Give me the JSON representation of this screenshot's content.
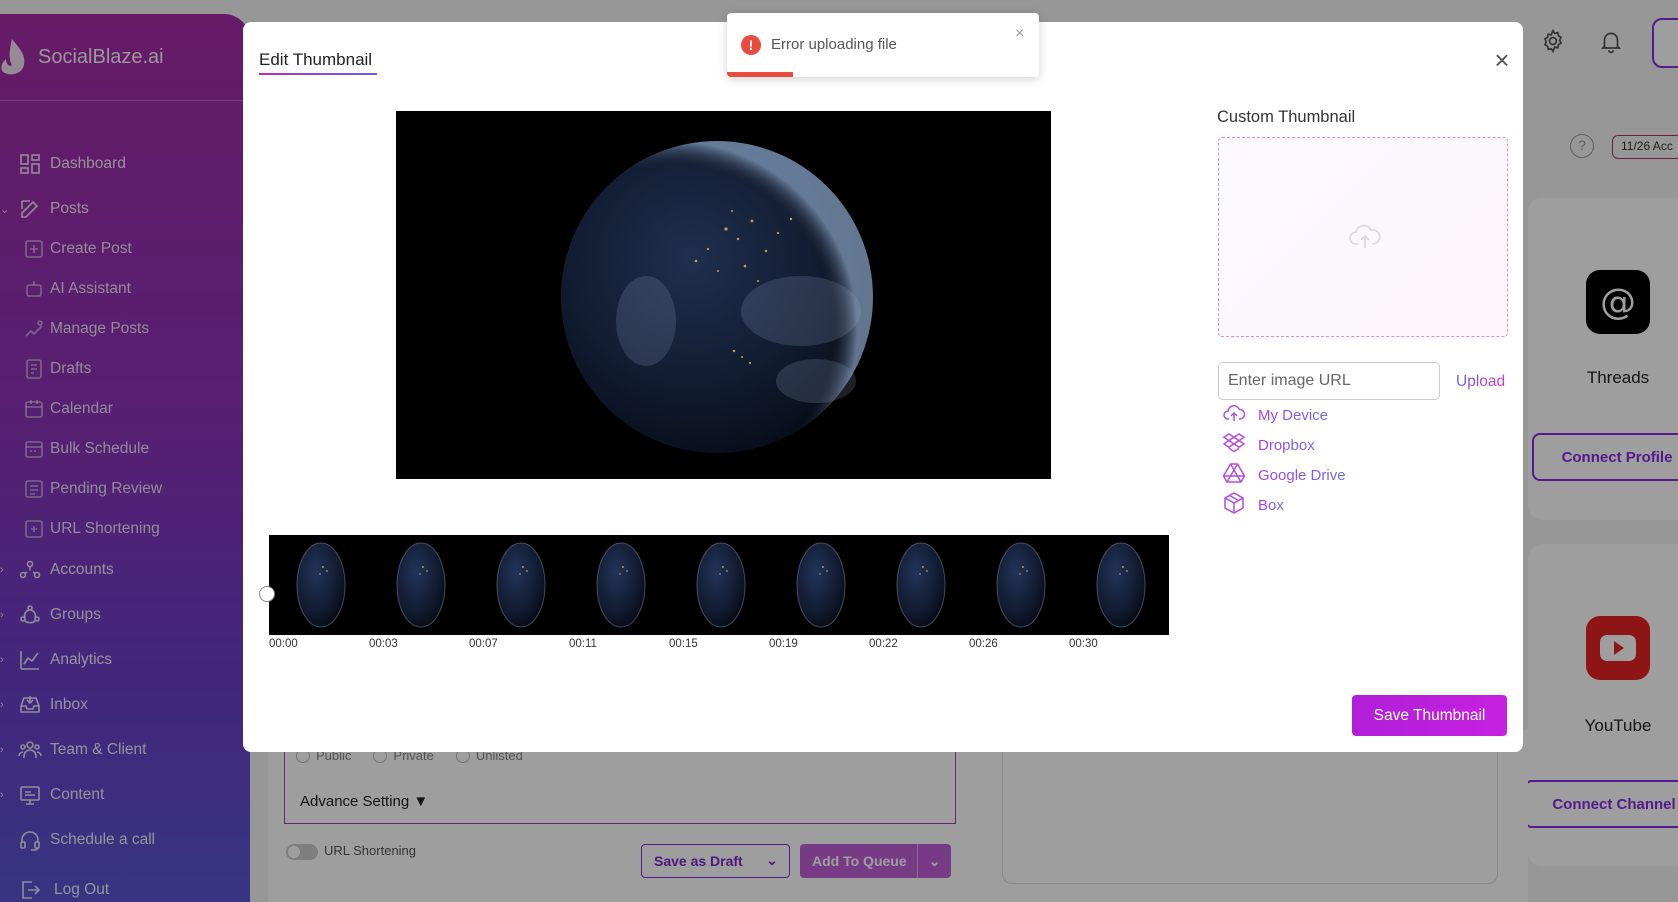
{
  "brand": {
    "name": "SocialBlaze.ai"
  },
  "sidebar": {
    "items": [
      {
        "label": "Dashboard",
        "icon": "dashboard-icon",
        "chevron": false,
        "sub": false
      },
      {
        "label": "Posts",
        "icon": "edit-icon",
        "chevron": "down",
        "sub": false
      },
      {
        "label": "Create Post",
        "icon": "create-post-icon",
        "chevron": false,
        "sub": true
      },
      {
        "label": "AI Assistant",
        "icon": "robot-icon",
        "chevron": false,
        "sub": true
      },
      {
        "label": "Manage Posts",
        "icon": "manage-icon",
        "chevron": false,
        "sub": true
      },
      {
        "label": "Drafts",
        "icon": "drafts-icon",
        "chevron": false,
        "sub": true
      },
      {
        "label": "Calendar",
        "icon": "calendar-icon",
        "chevron": false,
        "sub": true
      },
      {
        "label": "Bulk Schedule",
        "icon": "bulk-icon",
        "chevron": false,
        "sub": true
      },
      {
        "label": "Pending Review",
        "icon": "review-icon",
        "chevron": false,
        "sub": true
      },
      {
        "label": "URL Shortening",
        "icon": "link-icon",
        "chevron": false,
        "sub": true
      },
      {
        "label": "Accounts",
        "icon": "accounts-icon",
        "chevron": "right",
        "sub": false
      },
      {
        "label": "Groups",
        "icon": "groups-icon",
        "chevron": "right",
        "sub": false
      },
      {
        "label": "Analytics",
        "icon": "analytics-icon",
        "chevron": "right",
        "sub": false
      },
      {
        "label": "Inbox",
        "icon": "inbox-icon",
        "chevron": "right",
        "sub": false
      },
      {
        "label": "Team & Client",
        "icon": "team-icon",
        "chevron": "right",
        "sub": false
      },
      {
        "label": "Content",
        "icon": "content-icon",
        "chevron": "right",
        "sub": false
      },
      {
        "label": "Schedule a call",
        "icon": "headset-icon",
        "chevron": false,
        "sub": false
      },
      {
        "label": "Log Out",
        "icon": "logout-icon",
        "chevron": false,
        "sub": false
      }
    ]
  },
  "background": {
    "accounts_count": "11/26 Acc",
    "help": "?",
    "platforms": [
      {
        "name": "Threads",
        "button": "Connect Profile"
      },
      {
        "name": "YouTube",
        "button": "Connect Channel"
      }
    ],
    "visibility_options": [
      "Public",
      "Private",
      "Unlisted"
    ],
    "advance_setting": "Advance Setting ▼",
    "url_shortening": "URL Shortening",
    "save_draft": "Save as Draft",
    "add_queue": "Add To Queue"
  },
  "modal": {
    "title": "Edit Thumbnail",
    "close": "×",
    "custom_thumbnail_title": "Custom Thumbnail",
    "url_placeholder": "Enter image URL",
    "upload_label": "Upload",
    "sources": [
      {
        "label": "My Device",
        "icon": "cloud-upload-icon"
      },
      {
        "label": "Dropbox",
        "icon": "dropbox-icon"
      },
      {
        "label": "Google Drive",
        "icon": "google-drive-icon"
      },
      {
        "label": "Box",
        "icon": "box-icon"
      }
    ],
    "timeline": [
      "00:00",
      "00:03",
      "00:07",
      "00:11",
      "00:15",
      "00:19",
      "00:22",
      "00:26",
      "00:30"
    ],
    "save_button": "Save Thumbnail"
  },
  "toast": {
    "message": "Error uploading file",
    "icon": "!",
    "close": "×",
    "progress": 0.21,
    "color": "#e74c3c"
  },
  "colors": {
    "accent": "#b01fd8",
    "error": "#e74c3c"
  }
}
